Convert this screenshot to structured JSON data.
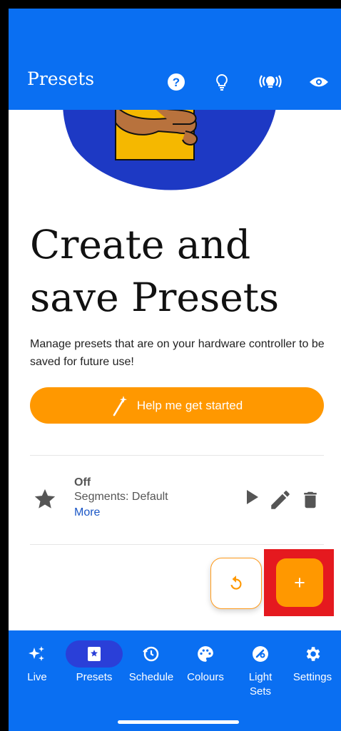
{
  "appbar": {
    "title": "Presets",
    "icons": [
      "help-icon",
      "bulb-icon",
      "light-broadcast-icon",
      "eye-icon"
    ]
  },
  "hero": {
    "title_line1": "Create and",
    "title_line2": "save Presets",
    "description": "Manage presets that are on your hardware controller to be saved for future use!",
    "cta_label": "Help me get started",
    "cta_icon": "magic-wand-icon"
  },
  "preset": {
    "name": "Off",
    "segments": "Segments: Default",
    "more": "More",
    "actions": [
      "play-icon",
      "edit-icon",
      "delete-icon"
    ]
  },
  "fab": {
    "refresh_icon": "refresh-icon",
    "add_label": "+"
  },
  "tabs": {
    "live": "Live",
    "presets": "Presets",
    "schedule": "Schedule",
    "colours": "Colours",
    "light_sets_1": "Light",
    "light_sets_2": "Sets",
    "settings": "Settings"
  },
  "colors": {
    "primary": "#0a6ff2",
    "accent": "#ff9800",
    "highlight": "#e5191f",
    "active_tab": "#2a3fd8",
    "link": "#1a56c6"
  }
}
